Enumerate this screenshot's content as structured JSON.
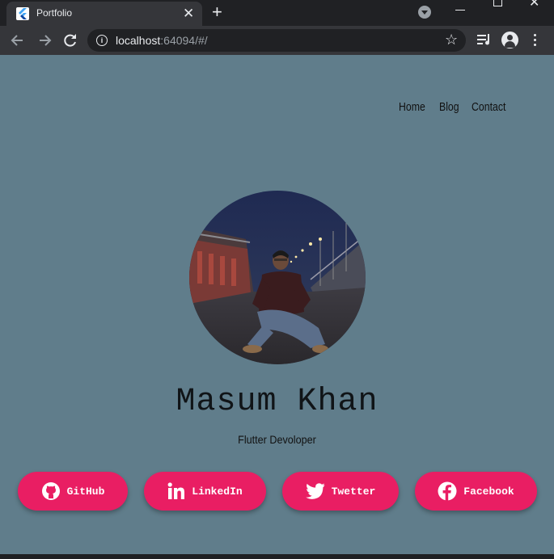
{
  "browser": {
    "tab_title": "Portfolio",
    "tab_close_glyph": "✕",
    "new_tab_glyph": "+",
    "url_host": "localhost",
    "url_rest": ":64094/#/",
    "star_glyph": "☆",
    "close_window_glyph": "✕"
  },
  "nav": {
    "items": [
      "Home",
      "Blog",
      "Contact"
    ]
  },
  "profile": {
    "name": "Masum Khan",
    "title": "Flutter Devoloper"
  },
  "social": [
    {
      "label": "GitHub",
      "icon": "github-icon"
    },
    {
      "label": "LinkedIn",
      "icon": "linkedin-icon"
    },
    {
      "label": "Twetter",
      "icon": "twitter-icon"
    },
    {
      "label": "Facebook",
      "icon": "facebook-icon"
    }
  ],
  "colors": {
    "page_background": "#607d8b",
    "button_background": "#e91e63",
    "text_dark": "#101417",
    "chrome_dark": "#202124",
    "chrome_toolbar": "#35363a"
  }
}
